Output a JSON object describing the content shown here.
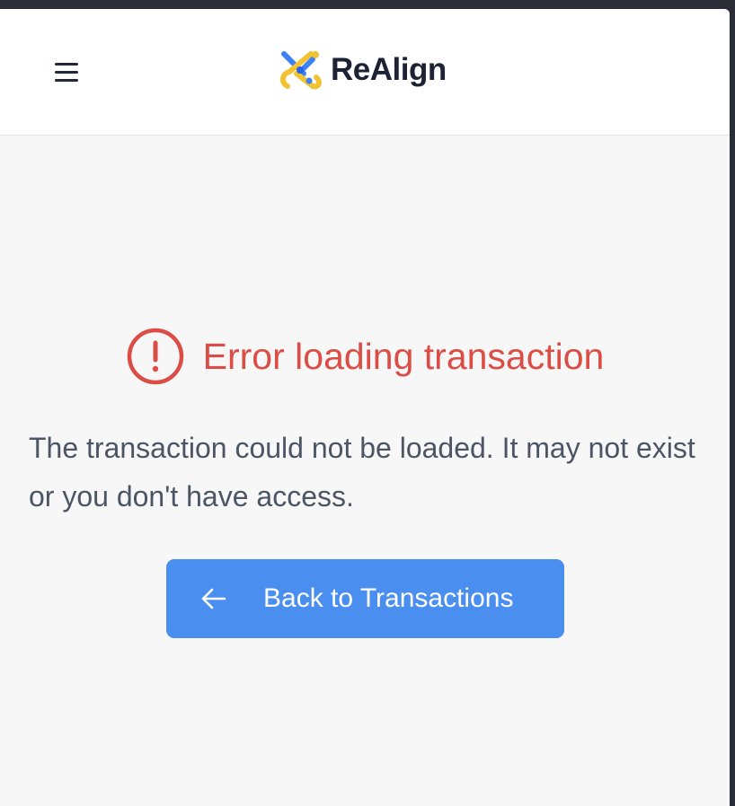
{
  "header": {
    "menu_icon": "hamburger-menu-icon",
    "brand_name": "ReAlign",
    "brand_logo_icon": "realign-logo-icon"
  },
  "error": {
    "icon": "exclamation-circle-icon",
    "title": "Error loading transaction",
    "message": "The transaction could not be loaded. It may not exist or you don't have access.",
    "color": "#dc4d45"
  },
  "actions": {
    "back_icon": "arrow-left-icon",
    "back_label": "Back to Transactions",
    "button_color": "#4a8ef0"
  }
}
